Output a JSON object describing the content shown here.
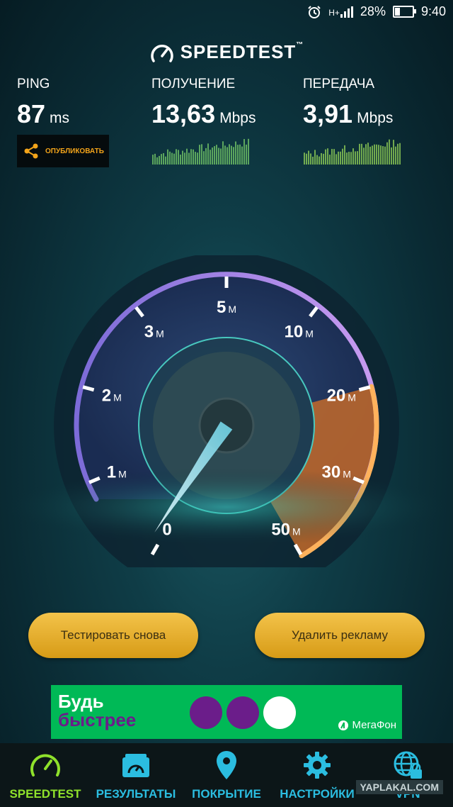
{
  "status_bar": {
    "network": "H+",
    "battery": "28%",
    "battery_level": 0.28,
    "time": "9:40",
    "icons": [
      "alarm-icon",
      "signal-icon",
      "battery-icon"
    ]
  },
  "brand": {
    "name": "SPEEDTEST",
    "tm": "™"
  },
  "metrics": {
    "ping": {
      "label": "PING",
      "value": "87",
      "unit": "ms"
    },
    "download": {
      "label": "ПОЛУЧЕНИЕ",
      "value": "13,63",
      "unit": "Mbps"
    },
    "upload": {
      "label": "ПЕРЕДАЧА",
      "value": "3,91",
      "unit": "Mbps"
    }
  },
  "share": {
    "label": "ОПУБЛИКОВАТЬ",
    "icon": "share-icon"
  },
  "gauge": {
    "ticks": [
      {
        "value": "0",
        "unit": ""
      },
      {
        "value": "1",
        "unit": "M"
      },
      {
        "value": "2",
        "unit": "M"
      },
      {
        "value": "3",
        "unit": "M"
      },
      {
        "value": "5",
        "unit": "M"
      },
      {
        "value": "10",
        "unit": "M"
      },
      {
        "value": "20",
        "unit": "M"
      },
      {
        "value": "30",
        "unit": "M"
      },
      {
        "value": "50",
        "unit": "M"
      }
    ],
    "needle_value": "0",
    "highlight_range": [
      "20",
      "50"
    ]
  },
  "buttons": {
    "retest": "Тестировать снова",
    "remove_ads": "Удалить рекламу"
  },
  "ad": {
    "line1": "Будь",
    "line2": "быстрее",
    "brand": "МегаФон",
    "colors": {
      "background": "#00b956",
      "purple": "#6b1d8a"
    }
  },
  "nav": [
    {
      "label": "SPEEDTEST",
      "icon": "gauge-icon",
      "active": true
    },
    {
      "label": "РЕЗУЛЬТАТЫ",
      "icon": "results-icon",
      "active": false
    },
    {
      "label": "ПОКРЫТИЕ",
      "icon": "location-pin-icon",
      "active": false
    },
    {
      "label": "НАСТРОЙКИ",
      "icon": "gear-icon",
      "active": false
    },
    {
      "label": "VPN",
      "icon": "vpn-globe-icon",
      "active": false
    }
  ],
  "watermark": "YAPLAKAL.COM",
  "colors": {
    "accent_green": "#8fe12b",
    "accent_blue": "#2bbde0",
    "accent_orange": "#f3a41a"
  }
}
